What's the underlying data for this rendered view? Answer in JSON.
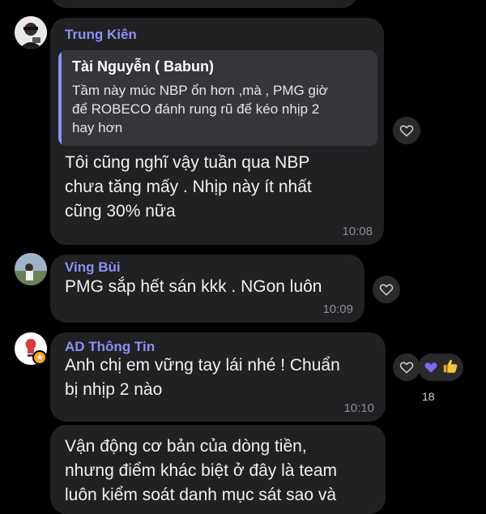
{
  "colors": {
    "background": "#000000",
    "bubble": "#212124",
    "sender_name": "#8f8ff5",
    "quote_bg": "#36363a",
    "timestamp": "#8c8c91",
    "heart_reaction": "#7c6cf0",
    "thumbs_reaction": "#f5c542"
  },
  "messages": [
    {
      "sender": "Trung Kiên",
      "avatar": "avatar-icon",
      "quote": {
        "author": "Tài Nguyễn ( Babun)",
        "text": "Tầm này múc NBP ổn hơn ,mà , PMG giờ\nđể ROBECO đánh rung rũ để kéo nhịp 2\nhay hơn"
      },
      "text": "Tôi cũng nghĩ vậy tuần qua NBP\nchưa tăng mấy . Nhịp này ít nhất\ncũng 30% nữa",
      "time": "10:08",
      "reaction_icon": "heart-outline-icon"
    },
    {
      "sender": "Ving Bùi",
      "avatar": "avatar-icon",
      "text": "PMG sắp hết sán kkk . NGon luôn",
      "time": "10:09",
      "reaction_icon": "heart-outline-icon"
    },
    {
      "sender": "AD Thông Tin",
      "avatar": "avatar-icon",
      "admin_badge": "star-badge-icon",
      "text": "Anh chị em vững tay lái nhé ! Chuẩn\nbị nhịp 2 nào",
      "time": "10:10",
      "reaction_icon": "heart-outline-icon",
      "reactions": [
        "heart-icon",
        "thumbs-up-icon"
      ],
      "reaction_count": "18"
    },
    {
      "text": "Vận động cơ bản của dòng tiền,\nnhưng điểm khác biệt ở đây là team\nluôn kiểm soát danh mục sát sao và"
    }
  ]
}
